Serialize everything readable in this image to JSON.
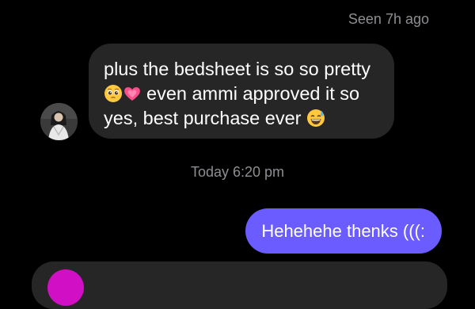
{
  "status": {
    "seen": "Seen 7h ago"
  },
  "incoming_message": {
    "line1": "plus the bedsheet is so so pretty",
    "line2_text": "even ammi approved it so",
    "line3_text": "yes, best purchase ever",
    "emojis": [
      "pleading-face",
      "growing-heart",
      "grinning-face-with-sweat"
    ]
  },
  "divider": {
    "timestamp": "Today 6:20 pm"
  },
  "outgoing_message": {
    "text": "Hehehehe thenks (((:"
  },
  "colors": {
    "background": "#000000",
    "incoming_bubble": "#262626",
    "outgoing_bubble": "#6b5cff",
    "meta_text": "#8e8e93"
  }
}
